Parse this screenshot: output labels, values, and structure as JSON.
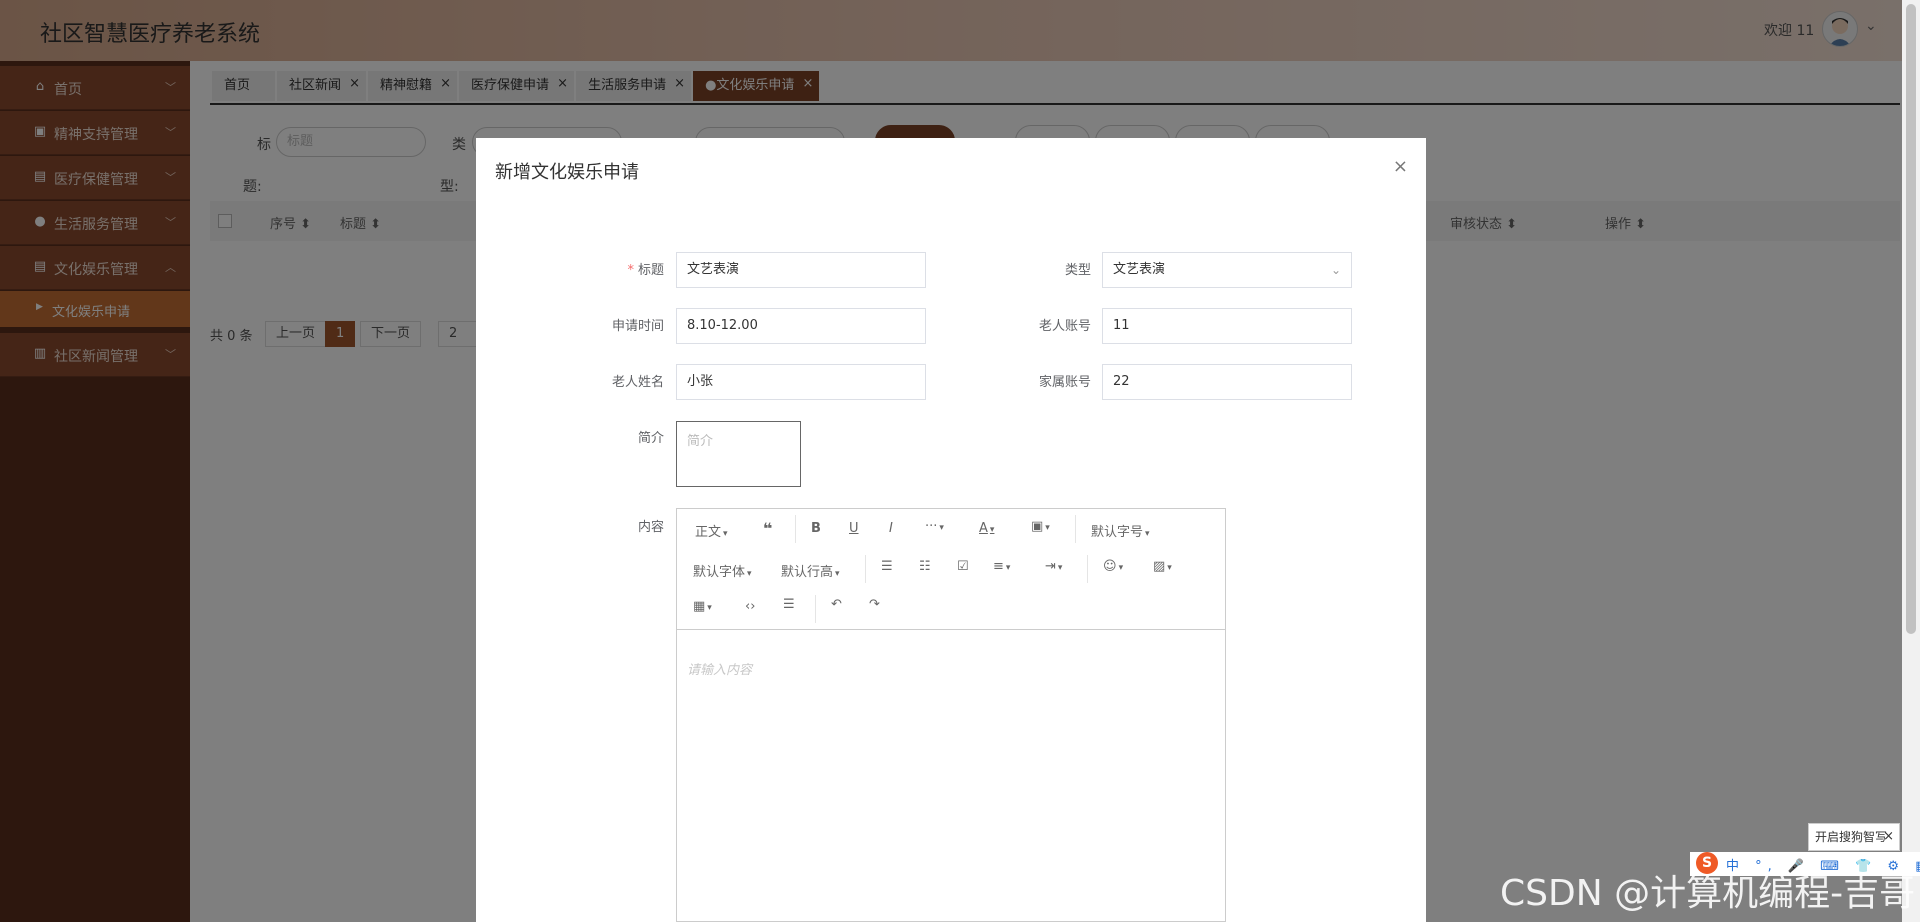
{
  "header": {
    "title": "社区智慧医疗养老系统",
    "welcome": "欢迎 11"
  },
  "sidebar": {
    "items": [
      {
        "label": "首页",
        "icon": "home-icon"
      },
      {
        "label": "精神支持管理",
        "icon": "support-icon"
      },
      {
        "label": "医疗保健管理",
        "icon": "medical-icon"
      },
      {
        "label": "生活服务管理",
        "icon": "service-icon"
      },
      {
        "label": "文化娱乐管理",
        "icon": "culture-icon"
      },
      {
        "label": "社区新闻管理",
        "icon": "news-icon"
      }
    ],
    "active_sub": "文化娱乐申请"
  },
  "tabs": [
    {
      "label": "首页",
      "closable": false
    },
    {
      "label": "社区新闻",
      "closable": true
    },
    {
      "label": "精神慰籍",
      "closable": true
    },
    {
      "label": "医疗保健申请",
      "closable": true
    },
    {
      "label": "生活服务申请",
      "closable": true
    },
    {
      "label": "●文化娱乐申请",
      "closable": true
    }
  ],
  "search": {
    "title_label": "标",
    "title_label2": "题:",
    "title_placeholder": "标题",
    "type_label": "类",
    "type_label2": "型:"
  },
  "table": {
    "col_no": "序号 ⬍",
    "col_title": "标题 ⬍",
    "col_status": "审核状态 ⬍",
    "col_action": "操作 ⬍"
  },
  "pager": {
    "total": "共 0 条",
    "prev": "上一页",
    "page": "1",
    "next": "下一页",
    "jump": "2"
  },
  "dialog": {
    "title": "新增文化娱乐申请",
    "close": "×",
    "fields": {
      "title_label": "标题",
      "title_value": "文艺表演",
      "type_label": "类型",
      "type_value": "文艺表演",
      "time_label": "申请时间",
      "time_value": "8.10-12.00",
      "elder_acc_label": "老人账号",
      "elder_acc_value": "11",
      "elder_name_label": "老人姓名",
      "elder_name_value": "小张",
      "family_acc_label": "家属账号",
      "family_acc_value": "22",
      "intro_label": "简介",
      "intro_placeholder": "简介",
      "content_label": "内容",
      "content_placeholder": "请输入内容"
    },
    "toolbar": {
      "paragraph": "正文",
      "font_size": "默认字号",
      "font_family": "默认字体",
      "line_height": "默认行高"
    }
  },
  "ime": {
    "tip": "开启搜狗智写",
    "close": "×",
    "logo": "S",
    "icons": "中 °, 🎤 ⌨ 👕 ⚙ ▦ ✿"
  },
  "watermark": "CSDN @计算机编程-吉哥"
}
